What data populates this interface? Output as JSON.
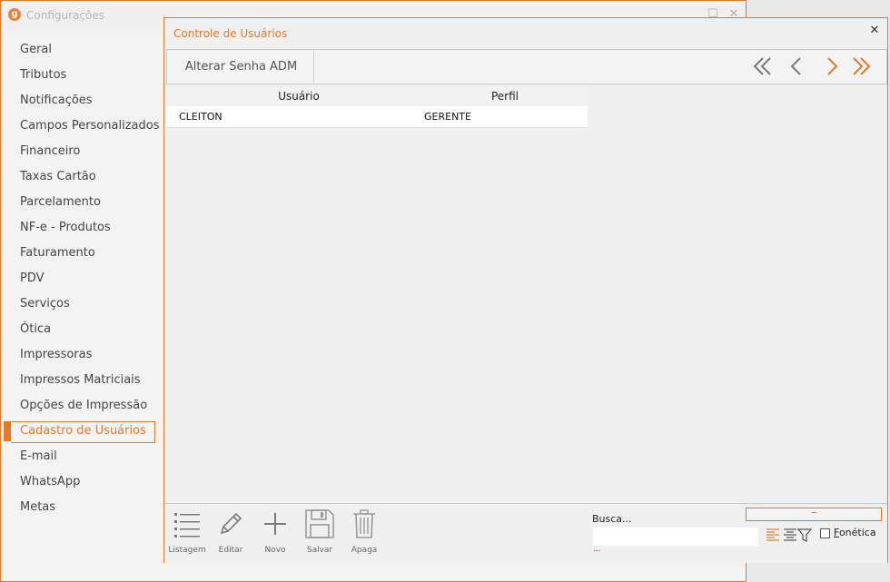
{
  "window": {
    "app_logo": "g",
    "title": "Configurações",
    "minimize_glyph": "▁",
    "maximize_glyph": "☐",
    "close_glyph": "✕"
  },
  "sidebar": {
    "items": [
      {
        "label": "Geral"
      },
      {
        "label": "Tributos"
      },
      {
        "label": "Notificações"
      },
      {
        "label": "Campos Personalizados"
      },
      {
        "label": "Financeiro"
      },
      {
        "label": "Taxas Cartão"
      },
      {
        "label": "Parcelamento"
      },
      {
        "label": "NF-e - Produtos"
      },
      {
        "label": "Faturamento"
      },
      {
        "label": "PDV"
      },
      {
        "label": "Serviços"
      },
      {
        "label": "Ótica"
      },
      {
        "label": "Impressoras"
      },
      {
        "label": "Impressos Matriciais"
      },
      {
        "label": "Opções de Impressão"
      },
      {
        "label": "Cadastro de Usuários",
        "active": true
      },
      {
        "label": "E-mail"
      },
      {
        "label": "WhatsApp"
      },
      {
        "label": "Metas"
      }
    ]
  },
  "dialog": {
    "title": "Controle de Usuários",
    "close_glyph": "✕",
    "toolbar": {
      "button_label": "Alterar Senha ADM",
      "nav_icons": [
        "first-page-icon",
        "previous-icon",
        "next-icon",
        "last-page-icon"
      ],
      "nav_colors": {
        "inactive": "#7a7a7a",
        "active": "#e07a2e"
      }
    },
    "grid": {
      "columns": [
        "Usuário",
        "Perfil"
      ],
      "rows": [
        [
          "CLEITON",
          "GERENTE"
        ]
      ]
    },
    "bottom": {
      "actions": [
        {
          "label": "Listagem",
          "icon": "list-icon"
        },
        {
          "label": "Editar",
          "icon": "pencil-icon"
        },
        {
          "label": "Novo",
          "icon": "plus-icon"
        },
        {
          "label": "Salvar",
          "icon": "save-icon"
        },
        {
          "label": "Apaga",
          "icon": "trash-icon"
        }
      ],
      "search_label": "Busca...",
      "search_value": "",
      "search_dots": "...",
      "phonetic_label": "onética",
      "phonetic_underline": "F",
      "phonetic_checked": false
    }
  },
  "colors": {
    "accent": "#e07a2e"
  }
}
